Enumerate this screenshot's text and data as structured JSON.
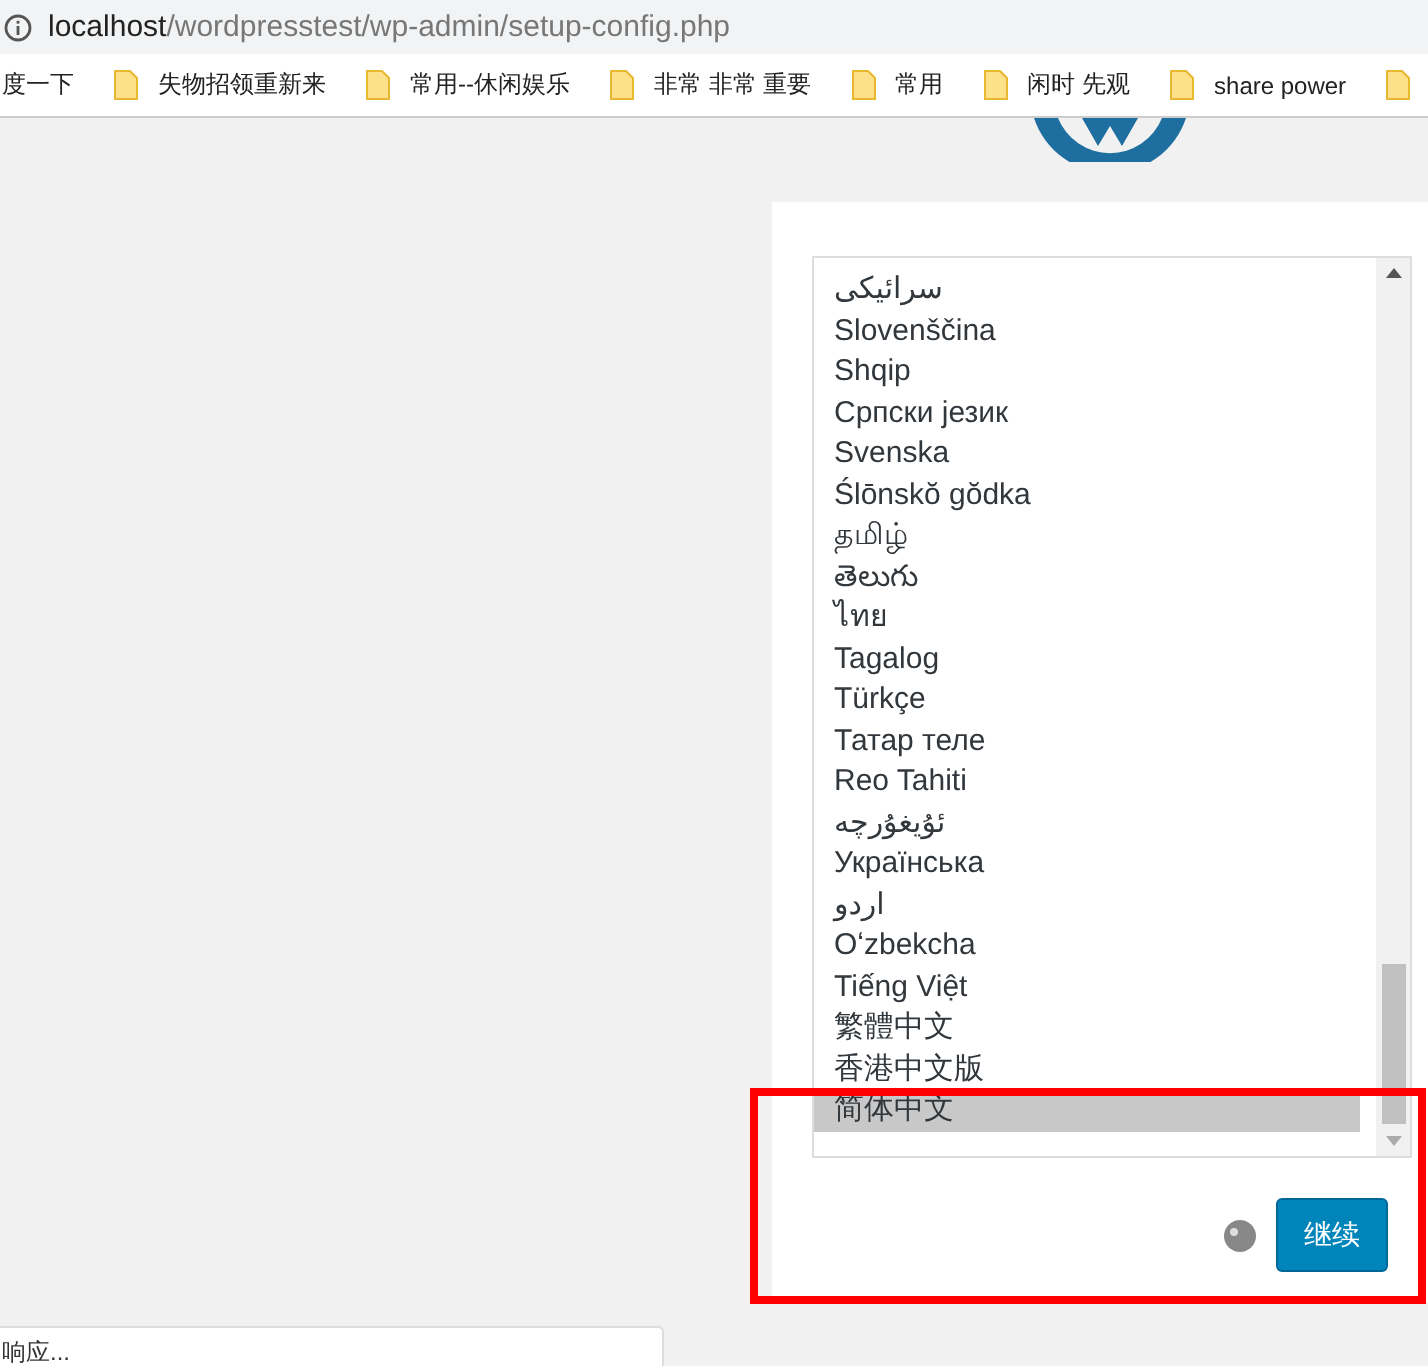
{
  "address_bar": {
    "host": "localhost",
    "path": "/wordpresstest/wp-admin/setup-config.php"
  },
  "bookmarks": [
    {
      "kind": "link",
      "label": "度一下"
    },
    {
      "kind": "folder",
      "label": "失物招领重新来"
    },
    {
      "kind": "folder",
      "label": "常用--休闲娱乐"
    },
    {
      "kind": "folder",
      "label": "非常 非常 重要"
    },
    {
      "kind": "folder",
      "label": "常用"
    },
    {
      "kind": "folder",
      "label": "闲时 先观"
    },
    {
      "kind": "folder",
      "label": "share power"
    },
    {
      "kind": "folder"
    }
  ],
  "languages": [
    {
      "label": "سرائیکی",
      "selected": false
    },
    {
      "label": "Slovenščina",
      "selected": false
    },
    {
      "label": "Shqip",
      "selected": false
    },
    {
      "label": "Српски језик",
      "selected": false
    },
    {
      "label": "Svenska",
      "selected": false
    },
    {
      "label": "Ślōnskŏ gŏdka",
      "selected": false
    },
    {
      "label": "தமிழ்",
      "selected": false
    },
    {
      "label": "తెలుగు",
      "selected": false
    },
    {
      "label": "ไทย",
      "selected": false
    },
    {
      "label": "Tagalog",
      "selected": false
    },
    {
      "label": "Türkçe",
      "selected": false
    },
    {
      "label": "Татар теле",
      "selected": false
    },
    {
      "label": "Reo Tahiti",
      "selected": false
    },
    {
      "label": "ئۇيغۇرچە",
      "selected": false
    },
    {
      "label": "Українська",
      "selected": false
    },
    {
      "label": "اردو",
      "selected": false
    },
    {
      "label": "Oʻzbekcha",
      "selected": false
    },
    {
      "label": "Tiếng Việt",
      "selected": false
    },
    {
      "label": "繁體中文",
      "selected": false
    },
    {
      "label": "香港中文版",
      "selected": false
    },
    {
      "label": "简体中文",
      "selected": true
    }
  ],
  "continue_button": "继续",
  "status_text": "响应..."
}
